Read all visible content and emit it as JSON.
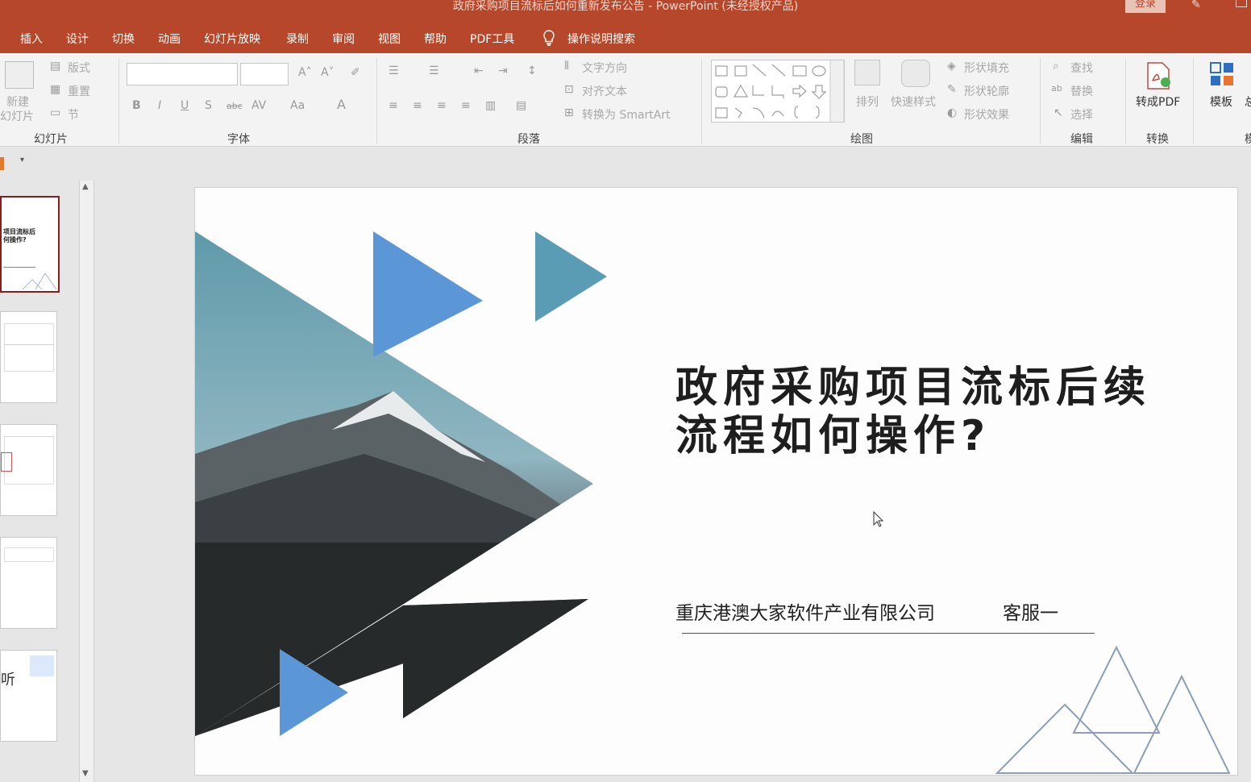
{
  "window": {
    "title": "政府采购项目流标后如何重新发布公告  -  PowerPoint (未经授权产品)",
    "login": "登录"
  },
  "tabs": [
    "插入",
    "设计",
    "切换",
    "动画",
    "幻灯片放映",
    "录制",
    "审阅",
    "视图",
    "帮助",
    "PDF工具"
  ],
  "tell_me": "操作说明搜索",
  "ribbon": {
    "slides": {
      "new_slide_1": "新建",
      "new_slide_2": "幻灯片",
      "layout": "版式",
      "reset": "重置",
      "section": "节",
      "group": "幻灯片"
    },
    "font": {
      "group": "字体"
    },
    "paragraph": {
      "text_direction": "文字方向",
      "align_text": "对齐文本",
      "smartart": "转换为 SmartArt",
      "group": "段落"
    },
    "drawing": {
      "arrange": "排列",
      "quick_styles": "快速样式",
      "shape_fill": "形状填充",
      "shape_outline": "形状轮廓",
      "shape_effects": "形状效果",
      "group": "绘图"
    },
    "editing": {
      "find": "查找",
      "replace": "替换",
      "select": "选择",
      "group": "编辑"
    },
    "convert": {
      "to_pdf": "转成PDF",
      "group": "转换"
    },
    "template": {
      "label": "模板",
      "cut1": "总",
      "cut2": "模"
    }
  },
  "thumbnails": {
    "t1_title": "项目流标后\n何操作?",
    "t5_text": "听"
  },
  "slide": {
    "title": "政府采购项目流标后续流程如何操作?",
    "company": "重庆港澳大家软件产业有限公司",
    "service": "客服一"
  },
  "colors": {
    "accent": "#b7472a",
    "triangle_blue": "#5b97d6",
    "triangle_teal": "#5a9cb3"
  }
}
